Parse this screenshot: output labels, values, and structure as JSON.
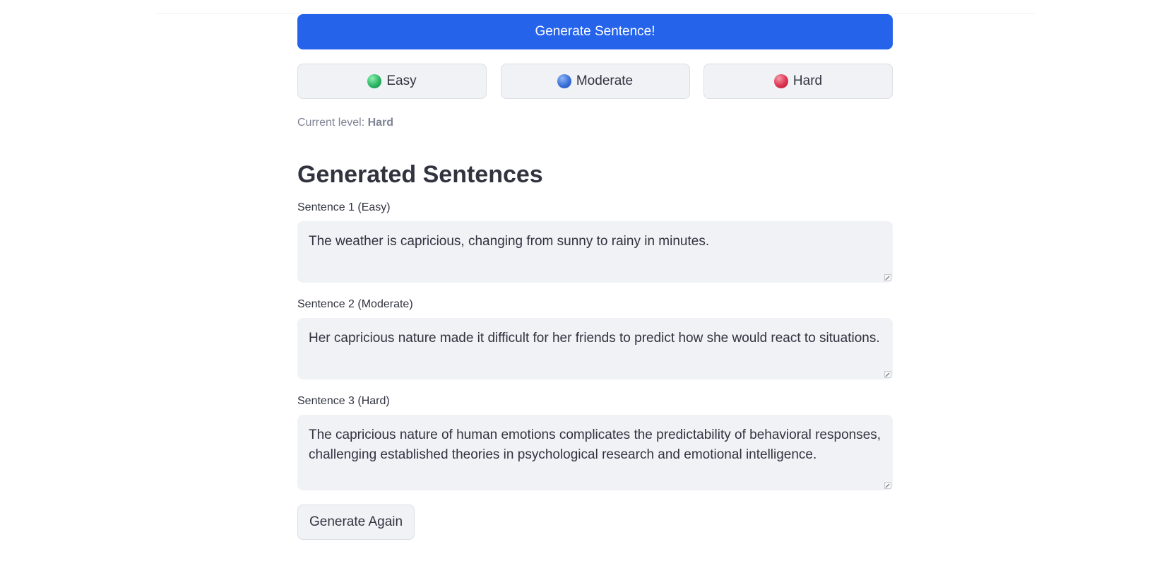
{
  "generate_button_label": "Generate Sentence!",
  "levels": [
    {
      "label": "Easy",
      "icon": "green-circle-icon",
      "color": "#2bb463"
    },
    {
      "label": "Moderate",
      "icon": "blue-circle-icon",
      "color": "#3a6fd8"
    },
    {
      "label": "Hard",
      "icon": "red-circle-icon",
      "color": "#dd3350"
    }
  ],
  "current_level": {
    "prefix": "Current level: ",
    "value": "Hard"
  },
  "section_title": "Generated Sentences",
  "sentences": [
    {
      "label": "Sentence 1 (Easy)",
      "text": "The weather is capricious, changing from sunny to rainy in minutes."
    },
    {
      "label": "Sentence 2 (Moderate)",
      "text": "Her capricious nature made it difficult for her friends to predict how she would react to situations."
    },
    {
      "label": "Sentence 3 (Hard)",
      "text": "The capricious nature of human emotions complicates the predictability of behavioral responses, challenging established theories in psychological research and emotional intelligence."
    }
  ],
  "generate_again_label": "Generate Again",
  "colors": {
    "primary": "#2563eb",
    "button_bg": "#f0f2f6",
    "text": "#31333f",
    "muted": "#808495"
  }
}
